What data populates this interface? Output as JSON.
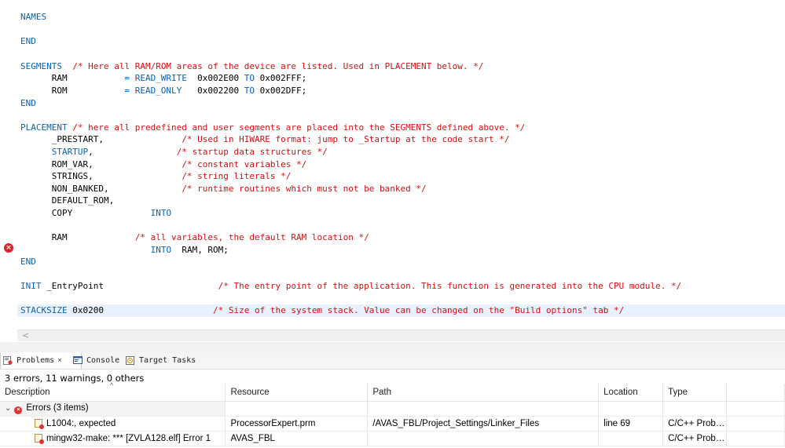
{
  "editor": {
    "lines": [
      {
        "segs": [
          {
            "t": "NAMES",
            "c": "kw"
          }
        ]
      },
      {
        "segs": [
          {
            "t": "END",
            "c": "kw"
          }
        ]
      },
      {
        "segs": [
          {
            "t": "SEGMENTS",
            "c": "kw"
          },
          {
            "t": "  /* Here all RAM/ROM areas of the device are listed. Used in PLACEMENT below. */",
            "c": "cm"
          }
        ]
      },
      {
        "segs": [
          {
            "t": "      RAM           ",
            "c": ""
          },
          {
            "t": "= READ_WRITE",
            "c": "kw"
          },
          {
            "t": "  0x002E00 ",
            "c": ""
          },
          {
            "t": "TO",
            "c": "kw"
          },
          {
            "t": " 0x002FFF;",
            "c": ""
          }
        ]
      },
      {
        "segs": [
          {
            "t": "      ROM           ",
            "c": ""
          },
          {
            "t": "= READ_ONLY",
            "c": "kw"
          },
          {
            "t": "   0x002200 ",
            "c": ""
          },
          {
            "t": "TO",
            "c": "kw"
          },
          {
            "t": " 0x002DFF;",
            "c": ""
          }
        ]
      },
      {
        "segs": [
          {
            "t": "END",
            "c": "kw"
          }
        ]
      },
      {
        "segs": [
          {
            "t": "PLACEMENT",
            "c": "kw"
          },
          {
            "t": " /* here all predefined and user segments are placed into the SEGMENTS defined above. */",
            "c": "cm"
          }
        ]
      },
      {
        "segs": [
          {
            "t": "      _PRESTART,               ",
            "c": ""
          },
          {
            "t": "/* Used in HIWARE format: jump to _Startup at the code start */",
            "c": "cm"
          }
        ]
      },
      {
        "segs": [
          {
            "t": "      ",
            "c": ""
          },
          {
            "t": "STARTUP",
            "c": "kw"
          },
          {
            "t": ",                ",
            "c": ""
          },
          {
            "t": "/* startup data structures */",
            "c": "cm"
          }
        ]
      },
      {
        "segs": [
          {
            "t": "      ROM_VAR,                 ",
            "c": ""
          },
          {
            "t": "/* constant variables */",
            "c": "cm"
          }
        ]
      },
      {
        "segs": [
          {
            "t": "      STRINGS,                 ",
            "c": ""
          },
          {
            "t": "/* string literals */",
            "c": "cm"
          }
        ]
      },
      {
        "segs": [
          {
            "t": "      NON_BANKED,              ",
            "c": ""
          },
          {
            "t": "/* runtime routines which must not be banked */",
            "c": "cm"
          }
        ]
      },
      {
        "segs": [
          {
            "t": "      DEFAULT_ROM,",
            "c": ""
          }
        ]
      },
      {
        "segs": [
          {
            "t": "      COPY               ",
            "c": ""
          },
          {
            "t": "INTO",
            "c": "kw"
          }
        ]
      },
      {
        "segs": [
          {
            "t": "      RAM             ",
            "c": ""
          },
          {
            "t": "/* all variables, the default RAM location */",
            "c": "cm"
          }
        ]
      },
      {
        "segs": [
          {
            "t": "                         ",
            "c": ""
          },
          {
            "t": "INTO",
            "c": "kw"
          },
          {
            "t": "  RAM, ROM;",
            "c": ""
          }
        ]
      },
      {
        "segs": [
          {
            "t": "END",
            "c": "kw"
          }
        ]
      },
      {
        "segs": [
          {
            "t": "INIT",
            "c": "kw"
          },
          {
            "t": " _EntryPoint                      ",
            "c": ""
          },
          {
            "t": "/* The entry point of the application. This function is generated into the CPU module. */",
            "c": "cm"
          }
        ]
      },
      {
        "segs": [
          {
            "t": "STACKSIZE",
            "c": "kw"
          },
          {
            "t": " 0x0200                     ",
            "c": ""
          },
          {
            "t": "/* Size of the system stack. Value can be changed on the \"Build options\" tab */",
            "c": "cm"
          }
        ]
      }
    ],
    "error_marker_symbol": "×",
    "scroll_left_symbol": "<"
  },
  "views": {
    "tabs": [
      {
        "label": "Problems",
        "icon": "problems-icon",
        "active": true,
        "close": "⨯"
      },
      {
        "label": "Console",
        "icon": "console-icon",
        "active": false
      },
      {
        "label": "Target Tasks",
        "icon": "target-tasks-icon",
        "active": false
      }
    ],
    "summary": "3 errors, 11 warnings, 0 others",
    "columns": [
      "Description",
      "Resource",
      "Path",
      "Location",
      "Type"
    ],
    "sort_symbol": "^",
    "group": {
      "label": "Errors (3 items)",
      "chevron": "⌄",
      "dot": "×"
    },
    "rows": [
      {
        "description": "L1004:, expected",
        "resource": "ProcessorExpert.prm",
        "path": "/AVAS_FBL/Project_Settings/Linker_Files",
        "location": "line 69",
        "type": "C/C++ Prob…"
      },
      {
        "description": "mingw32-make: *** [ZVLA128.elf] Error 1",
        "resource": "AVAS_FBL",
        "path": "",
        "location": "",
        "type": "C/C++ Prob…"
      }
    ],
    "colors": {
      "keyword": "#0b62ae",
      "comment": "#d40f0f",
      "error": "#e0312f",
      "highlight": "#e8f2fe"
    }
  }
}
